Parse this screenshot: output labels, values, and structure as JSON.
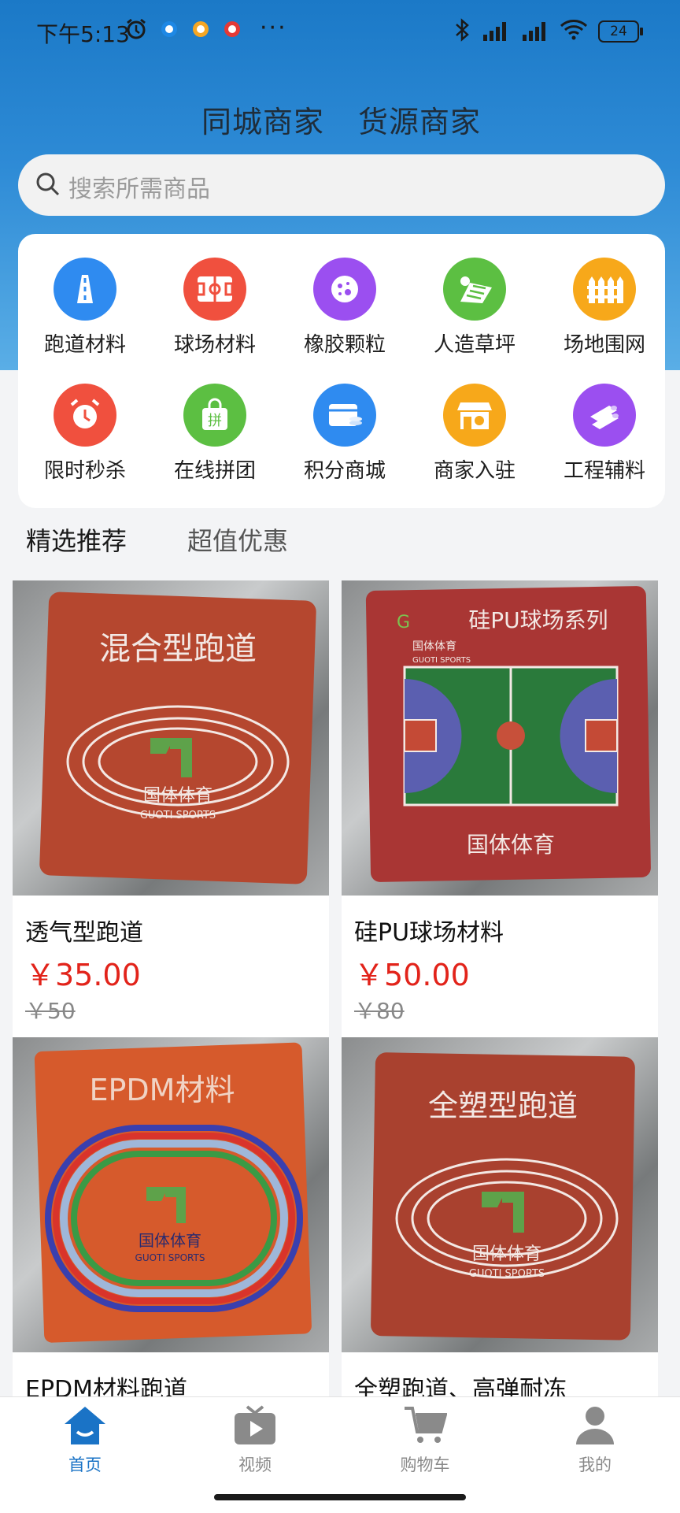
{
  "status_bar": {
    "time": "下午5:13",
    "battery": "24"
  },
  "top_tabs": [
    "同城商家",
    "货源商家"
  ],
  "search": {
    "placeholder": "搜索所需商品"
  },
  "categories": [
    {
      "label": "跑道材料",
      "color": "#2f8bf0",
      "icon": "road-icon"
    },
    {
      "label": "球场材料",
      "color": "#f0503e",
      "icon": "court-icon"
    },
    {
      "label": "橡胶颗粒",
      "color": "#9b4ff0",
      "icon": "granule-icon"
    },
    {
      "label": "人造草坪",
      "color": "#5cbf42",
      "icon": "turf-icon"
    },
    {
      "label": "场地围网",
      "color": "#f7a81a",
      "icon": "fence-icon"
    },
    {
      "label": "限时秒杀",
      "color": "#f0503e",
      "icon": "alarm-clock-icon"
    },
    {
      "label": "在线拼团",
      "color": "#5cbf42",
      "icon": "group-buy-bag-icon"
    },
    {
      "label": "积分商城",
      "color": "#2f8bf0",
      "icon": "points-mall-icon"
    },
    {
      "label": "商家入驻",
      "color": "#f7a81a",
      "icon": "merchant-store-icon"
    },
    {
      "label": "工程辅料",
      "color": "#9b4ff0",
      "icon": "pipes-icon"
    }
  ],
  "section_tabs": [
    "精选推荐",
    "超值优惠"
  ],
  "products": [
    {
      "name": "透气型跑道",
      "price": "￥35.00",
      "original": "￥50",
      "image_text": "混合型跑道",
      "brand": "国体体育",
      "brand_en": "GUOTI SPORTS",
      "color": "#b5472f"
    },
    {
      "name": "硅PU球场材料",
      "price": "￥50.00",
      "original": "￥80",
      "image_text": "硅PU球场系列",
      "brand": "国体体育",
      "brand_en": "GUOTI SPORTS",
      "color": "#a93634"
    },
    {
      "name": "EPDM材料跑道",
      "price": "",
      "original": "",
      "image_text": "EPDM材料",
      "brand": "国体体育",
      "brand_en": "GUOTI SPORTS",
      "color": "#d65a2c"
    },
    {
      "name": "全塑跑道、高弹耐冻",
      "price": "",
      "original": "",
      "image_text": "全塑型跑道",
      "brand": "国体体育",
      "brand_en": "GUOTI SPORTS",
      "color": "#a9412f"
    }
  ],
  "bottom_nav": [
    {
      "label": "首页",
      "icon": "home-icon",
      "active": true
    },
    {
      "label": "视频",
      "icon": "video-tv-icon",
      "active": false
    },
    {
      "label": "购物车",
      "icon": "shopping-cart-icon",
      "active": false
    },
    {
      "label": "我的",
      "icon": "user-profile-icon",
      "active": false
    }
  ],
  "colors": {
    "accent": "#1a73c6",
    "price": "#e2231a",
    "header_top": "#1b79c7"
  }
}
